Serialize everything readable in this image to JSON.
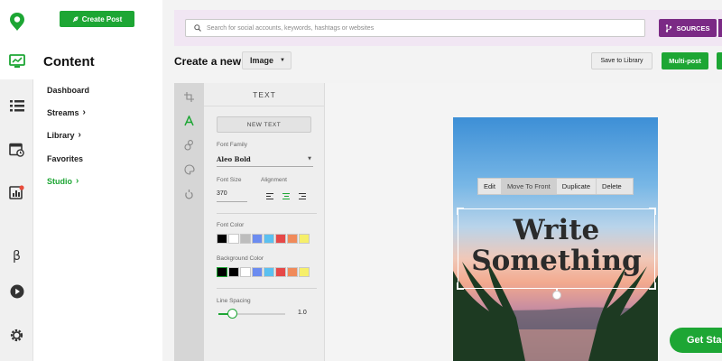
{
  "rail": {
    "icons": [
      "app-logo-icon",
      "compose-icon",
      "list-icon",
      "calendar-icon",
      "analytics-icon",
      "beta-icon",
      "play-icon",
      "gear-icon"
    ],
    "beta_label": "β"
  },
  "nav": {
    "create_post_label": "Create Post",
    "title": "Content",
    "items": [
      {
        "label": "Dashboard",
        "chevron": ""
      },
      {
        "label": "Streams",
        "chevron": "›"
      },
      {
        "label": "Library",
        "chevron": "›"
      },
      {
        "label": "Favorites",
        "chevron": ""
      },
      {
        "label": "Studio",
        "chevron": "›"
      }
    ],
    "active_item": "Studio"
  },
  "header": {
    "search_placeholder": "Search for social accounts, keywords, hashtags or websites",
    "sources_label": "SOURCES",
    "create_new_label": "Create a new",
    "type_value": "Image",
    "save_library_label": "Save to Library",
    "multi_post_label": "Multi-post"
  },
  "tools": [
    "crop-icon",
    "text-icon",
    "shapes-icon",
    "palette-icon",
    "fill-icon"
  ],
  "text_panel": {
    "title": "TEXT",
    "new_text_label": "NEW TEXT",
    "font_family_label": "Font Family",
    "font_family_value": "Aleo Bold",
    "font_size_label": "Font Size",
    "font_size_value": "370",
    "alignment_label": "Alignment",
    "alignment_selected": "center",
    "font_color_label": "Font Color",
    "font_colors": [
      "#000000",
      "#ffffff",
      "#bdbdbd",
      "#6c8cf0",
      "#5bc0f0",
      "#e64848",
      "#f08a5a",
      "#f6ef6a"
    ],
    "background_color_label": "Background Color",
    "background_colors": [
      "#000000",
      "#000000",
      "#ffffff",
      "#6c8cf0",
      "#5bc0f0",
      "#e64848",
      "#f08a5a",
      "#f6ef6a"
    ],
    "line_spacing_label": "Line Spacing",
    "line_spacing_value": "1.0",
    "line_spacing_fraction": 0.2
  },
  "canvas": {
    "context_menu": [
      "Edit",
      "Move To Front",
      "Duplicate",
      "Delete"
    ],
    "text_line_1": "Write",
    "text_line_2": "Something"
  },
  "cta": {
    "get_started_label": "Get Sta"
  },
  "colors": {
    "brand_green": "#1da634",
    "sources_purple": "#7b2a85",
    "search_bar_bg": "#f1e6f3"
  }
}
